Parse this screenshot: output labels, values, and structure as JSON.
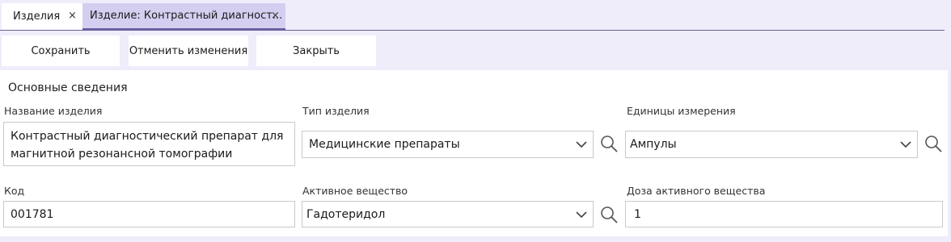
{
  "tabs": [
    {
      "label": "Изделия",
      "close": "×"
    },
    {
      "label": "Изделие: Контрастный диагност...",
      "close": "×"
    }
  ],
  "toolbar": {
    "save_label": "Сохранить",
    "cancel_label": "Отменить изменения",
    "close_label": "Закрыть"
  },
  "section": {
    "title": "Основные сведения"
  },
  "fields": {
    "name": {
      "label": "Название изделия",
      "value": "Контрастный диагностический препарат для магнитной резонансной томографии"
    },
    "type": {
      "label": "Тип изделия",
      "value": "Медицинские препараты"
    },
    "units": {
      "label": "Единицы измерения",
      "value": "Ампулы"
    },
    "code": {
      "label": "Код",
      "value": "001781"
    },
    "substance": {
      "label": "Активное вещество",
      "value": "Гадотеридол"
    },
    "dose": {
      "label": "Доза активного вещества",
      "value": "1"
    }
  },
  "icons": {
    "dropdown": "chevron-down-icon",
    "search": "search-icon",
    "close": "close-icon"
  },
  "colors": {
    "background": "#efedfa",
    "active_tab": "#d4cff0",
    "accent": "#6b5f9e"
  }
}
